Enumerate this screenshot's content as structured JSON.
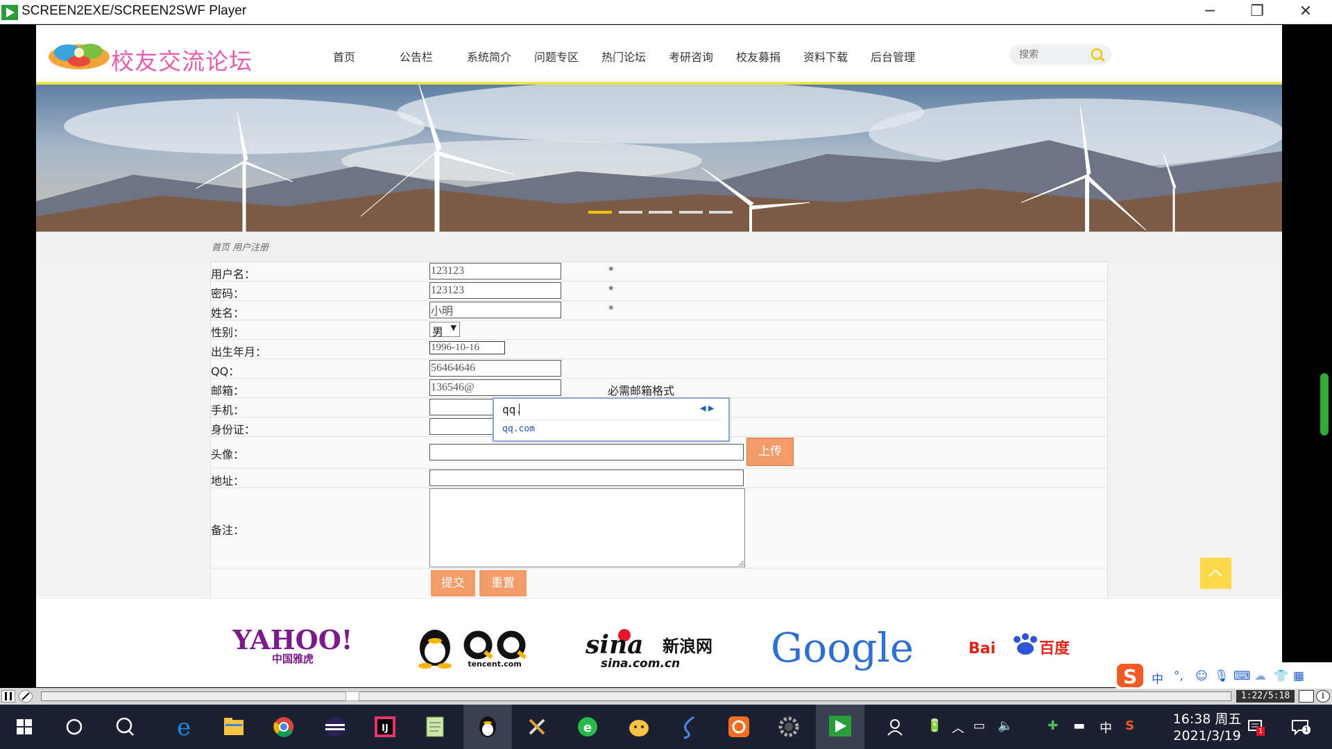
{
  "window": {
    "title": "SCREEN2EXE/SCREEN2SWF Player",
    "minimize": "─",
    "restore": "❐",
    "close": "✕"
  },
  "site": {
    "logo_text": "校友交流论坛"
  },
  "nav": [
    "首页",
    "公告栏",
    "系统简介",
    "问题专区",
    "热门论坛",
    "考研咨询",
    "校友募捐",
    "资料下载",
    "后台管理"
  ],
  "search": {
    "placeholder": "搜索"
  },
  "breadcrumb": "首页 用户注册",
  "form": {
    "username_label": "用户名：",
    "username_value": "123123",
    "password_label": "密码：",
    "password_value": "123123",
    "name_label": "姓名：",
    "name_value": "小明",
    "gender_label": "性别：",
    "gender_value": "男",
    "birth_label": "出生年月：",
    "birth_value": "1996-10-16",
    "qq_label": "QQ：",
    "qq_value": "56464646",
    "email_label": "邮箱：",
    "email_value": "136546@",
    "email_hint": "必需邮箱格式",
    "phone_label": "手机：",
    "idcard_label": "身份证：",
    "avatar_label": "头像：",
    "upload_label": "上传",
    "address_label": "地址：",
    "remarks_label": "备注：",
    "required_mark": "*",
    "submit_label": "提交",
    "reset_label": "重置"
  },
  "ime": {
    "input": "qq.",
    "candidate": "qq.com"
  },
  "footer_logos": {
    "yahoo": "YAHOO!",
    "yahoo_sub": "中国雅虎",
    "qq_sub": "tencent.com",
    "sina": "sina",
    "sina_cn": "新浪网",
    "sina_sub": "sina.com.cn",
    "google": "Google",
    "baidu": "Bai",
    "baidu_cn": "百度"
  },
  "ime_bar": {
    "lang": "中",
    "punct": "°,"
  },
  "player": {
    "time": "1:22/5:18",
    "info": "i"
  },
  "taskbar": {
    "clock_time": "16:38 周五",
    "clock_date": "2021/3/19",
    "ime_lang": "中",
    "notif_count": "1",
    "action_count": "1"
  },
  "colors": {
    "accent_orange": "#f49b6a",
    "logo_pink": "#e75cad",
    "banner_line": "#e9e34a",
    "back_to_top": "#fbd94a"
  }
}
